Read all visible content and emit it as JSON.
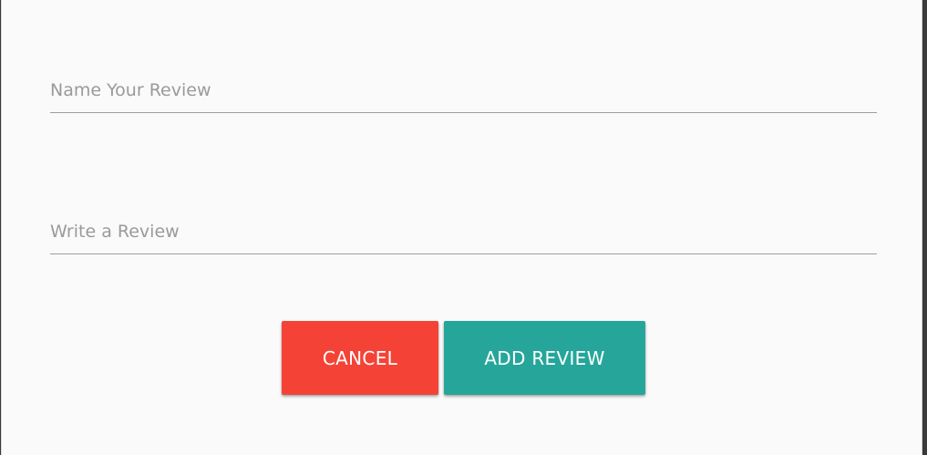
{
  "form": {
    "name_field": {
      "value": "",
      "placeholder": "Name Your Review"
    },
    "review_field": {
      "value": "",
      "placeholder": "Write a Review"
    }
  },
  "actions": {
    "cancel_label": "CANCEL",
    "add_label": "ADD REVIEW"
  },
  "colors": {
    "cancel": "#f44336",
    "add": "#26a69a",
    "dialog_background": "#fafafa"
  }
}
